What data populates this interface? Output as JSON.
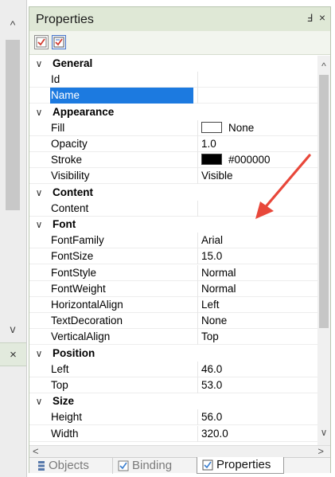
{
  "side_strip": {
    "scroll_up_glyph": "^",
    "scroll_down_glyph": "v",
    "close_glyph": "×"
  },
  "panel": {
    "title": "Properties",
    "pin_glyph": "Ⅎ",
    "close_glyph": "×"
  },
  "toolbar": {
    "buttons": [
      {
        "icon": "categorized-icon",
        "selected": false
      },
      {
        "icon": "alphabetical-icon",
        "selected": true
      }
    ]
  },
  "grid": {
    "rows": [
      {
        "kind": "category",
        "chevron": "∨",
        "label": "General"
      },
      {
        "kind": "property",
        "label": "Id",
        "value": ""
      },
      {
        "kind": "property",
        "label": "Name",
        "value": "",
        "selected": true
      },
      {
        "kind": "category",
        "chevron": "∨",
        "label": "Appearance"
      },
      {
        "kind": "property",
        "label": "Fill",
        "value": "None",
        "swatch": "#ffffff"
      },
      {
        "kind": "property",
        "label": "Opacity",
        "value": "1.0"
      },
      {
        "kind": "property",
        "label": "Stroke",
        "value": "#000000",
        "swatch": "#000000"
      },
      {
        "kind": "property",
        "label": "Visibility",
        "value": "Visible"
      },
      {
        "kind": "category",
        "chevron": "∨",
        "label": "Content"
      },
      {
        "kind": "property",
        "label": "Content",
        "value": ""
      },
      {
        "kind": "category",
        "chevron": "∨",
        "label": "Font"
      },
      {
        "kind": "property",
        "label": "FontFamily",
        "value": "Arial"
      },
      {
        "kind": "property",
        "label": "FontSize",
        "value": "15.0"
      },
      {
        "kind": "property",
        "label": "FontStyle",
        "value": "Normal"
      },
      {
        "kind": "property",
        "label": "FontWeight",
        "value": "Normal"
      },
      {
        "kind": "property",
        "label": "HorizontalAlign",
        "value": "Left"
      },
      {
        "kind": "property",
        "label": "TextDecoration",
        "value": "None"
      },
      {
        "kind": "property",
        "label": "VerticalAlign",
        "value": "Top"
      },
      {
        "kind": "category",
        "chevron": "∨",
        "label": "Position"
      },
      {
        "kind": "property",
        "label": "Left",
        "value": "46.0"
      },
      {
        "kind": "property",
        "label": "Top",
        "value": "53.0"
      },
      {
        "kind": "category",
        "chevron": "∨",
        "label": "Size"
      },
      {
        "kind": "property",
        "label": "Height",
        "value": "56.0"
      },
      {
        "kind": "property",
        "label": "Width",
        "value": "320.0"
      }
    ]
  },
  "scrollbars": {
    "up_glyph": "^",
    "down_glyph": "∨",
    "left_glyph": "<",
    "right_glyph": ">"
  },
  "tabs": [
    {
      "label": "Objects",
      "icon": "objects-icon",
      "active": false
    },
    {
      "label": "Binding",
      "icon": "binding-icon",
      "active": false
    },
    {
      "label": "Properties",
      "icon": "properties-icon",
      "active": true
    }
  ],
  "colors": {
    "title_bg": "#dfe8d6",
    "selection": "#1c7ae0",
    "annotation_arrow": "#e8473a"
  }
}
